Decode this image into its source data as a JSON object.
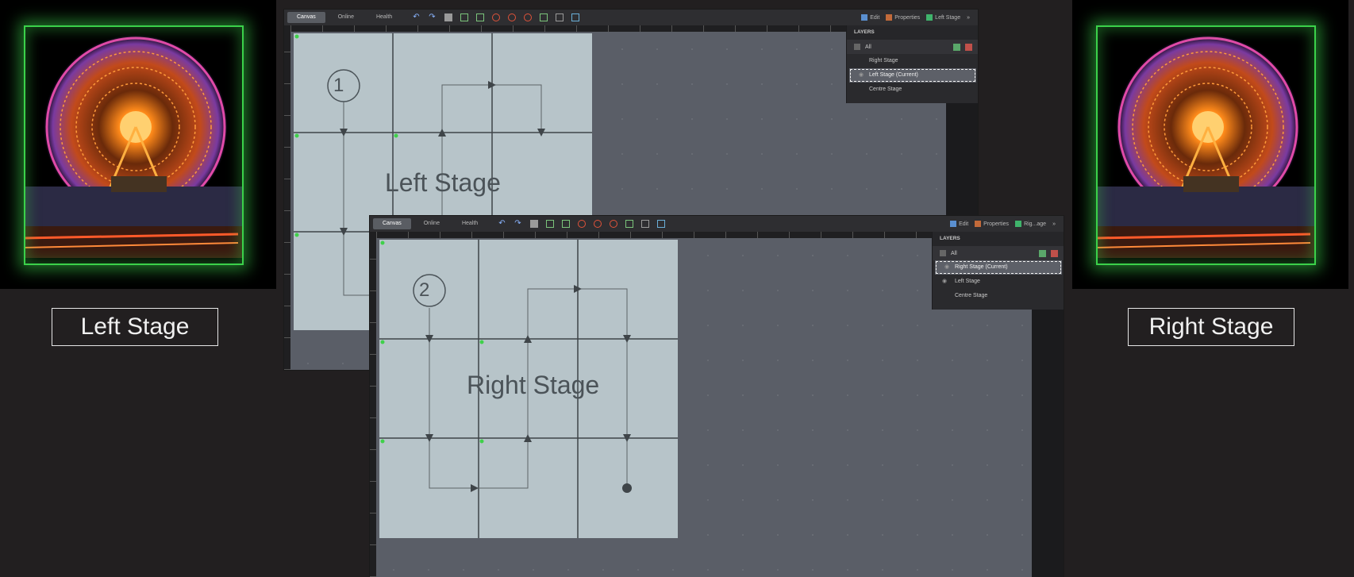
{
  "left_photo": {
    "label": "Left Stage"
  },
  "right_photo": {
    "label": "Right Stage"
  },
  "window1": {
    "tabs": [
      "Canvas",
      "Online",
      "Health"
    ],
    "toolbar_right": {
      "edit": "Edit",
      "properties": "Properties",
      "layer_name": "Left Stage"
    },
    "stage_number": "1",
    "stage_text": "Left Stage",
    "layers": {
      "title": "LAYERS",
      "all": "All",
      "items": [
        "Right Stage",
        "Left Stage (Current)",
        "Centre Stage"
      ]
    }
  },
  "window2": {
    "tabs": [
      "Canvas",
      "Online",
      "Health"
    ],
    "toolbar_right": {
      "edit": "Edit",
      "properties": "Properties",
      "layer_name": "Rig...age"
    },
    "stage_number": "2",
    "stage_text": "Right Stage",
    "layers": {
      "title": "LAYERS",
      "all": "All",
      "items": [
        "Right Stage (Current)",
        "Left Stage",
        "Centre Stage"
      ]
    }
  },
  "colors": {
    "background": "#221f20",
    "glow": "#3bd14a",
    "grid": "#b7c4c9",
    "workspace": "#5a5e67"
  }
}
